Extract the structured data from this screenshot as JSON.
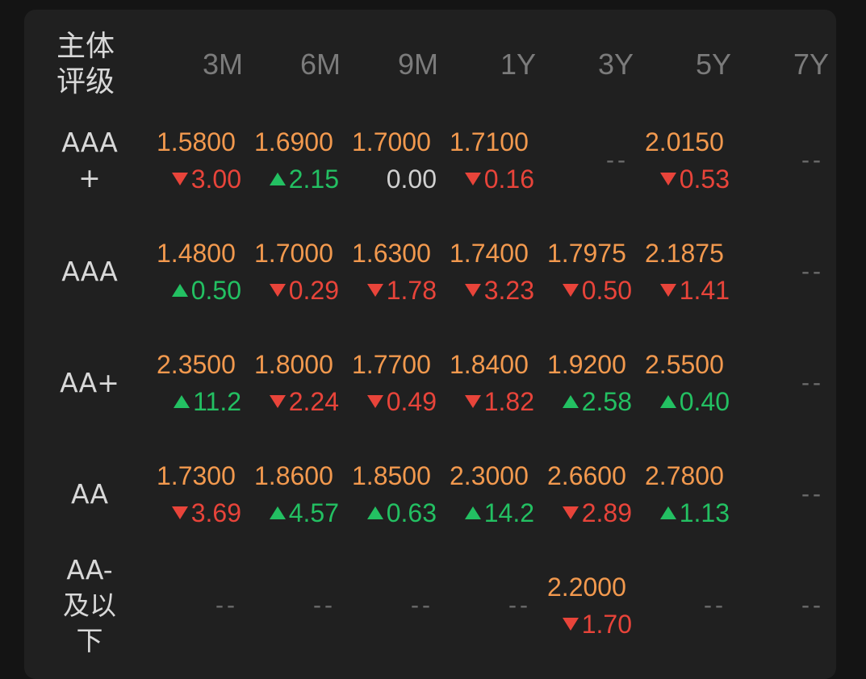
{
  "corner": {
    "line1": "主体",
    "line2": "评级"
  },
  "columns": [
    "3M",
    "6M",
    "9M",
    "1Y",
    "3Y",
    "5Y",
    "7Y"
  ],
  "empty_label": "--",
  "rows": [
    {
      "rating": [
        "AAA",
        "+"
      ],
      "cells": [
        {
          "value": "1.5800",
          "change": "3.00",
          "dir": "down"
        },
        {
          "value": "1.6900",
          "change": "2.15",
          "dir": "up"
        },
        {
          "value": "1.7000",
          "change": "0.00",
          "dir": "flat"
        },
        {
          "value": "1.7100",
          "change": "0.16",
          "dir": "down"
        },
        null,
        {
          "value": "2.0150",
          "change": "0.53",
          "dir": "down"
        },
        null
      ]
    },
    {
      "rating": [
        "AAA"
      ],
      "cells": [
        {
          "value": "1.4800",
          "change": "0.50",
          "dir": "up"
        },
        {
          "value": "1.7000",
          "change": "0.29",
          "dir": "down"
        },
        {
          "value": "1.6300",
          "change": "1.78",
          "dir": "down"
        },
        {
          "value": "1.7400",
          "change": "3.23",
          "dir": "down"
        },
        {
          "value": "1.7975",
          "change": "0.50",
          "dir": "down"
        },
        {
          "value": "2.1875",
          "change": "1.41",
          "dir": "down"
        },
        null
      ]
    },
    {
      "rating": [
        "AA+"
      ],
      "cells": [
        {
          "value": "2.3500",
          "change": "11.2",
          "dir": "up"
        },
        {
          "value": "1.8000",
          "change": "2.24",
          "dir": "down"
        },
        {
          "value": "1.7700",
          "change": "0.49",
          "dir": "down"
        },
        {
          "value": "1.8400",
          "change": "1.82",
          "dir": "down"
        },
        {
          "value": "1.9200",
          "change": "2.58",
          "dir": "up"
        },
        {
          "value": "2.5500",
          "change": "0.40",
          "dir": "up"
        },
        null
      ]
    },
    {
      "rating": [
        "AA"
      ],
      "cells": [
        {
          "value": "1.7300",
          "change": "3.69",
          "dir": "down"
        },
        {
          "value": "1.8600",
          "change": "4.57",
          "dir": "up"
        },
        {
          "value": "1.8500",
          "change": "0.63",
          "dir": "up"
        },
        {
          "value": "2.3000",
          "change": "14.2",
          "dir": "up"
        },
        {
          "value": "2.6600",
          "change": "2.89",
          "dir": "down"
        },
        {
          "value": "2.7800",
          "change": "1.13",
          "dir": "up"
        },
        null
      ]
    },
    {
      "rating": [
        "AA-",
        "及以",
        "下"
      ],
      "cells": [
        null,
        null,
        null,
        null,
        {
          "value": "2.2000",
          "change": "1.70",
          "dir": "down"
        },
        null,
        null
      ]
    }
  ],
  "colors": {
    "value": "#f2994e",
    "down": "#e8443a",
    "up": "#23c062",
    "flat": "#d0d0d0",
    "background": "#202020"
  }
}
